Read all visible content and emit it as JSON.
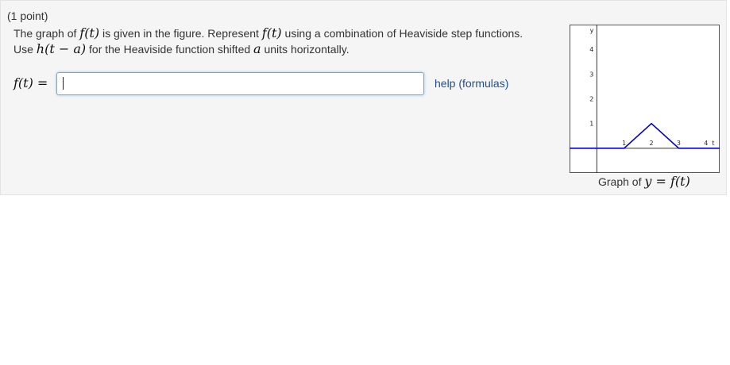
{
  "problem": {
    "points": "(1 point)",
    "line1": {
      "t1": "The graph of ",
      "m1": "f(t)",
      "t2": " is given in the figure. Represent ",
      "m2": "f(t)",
      "t3": " using a combination of Heaviside step functions."
    },
    "line2": {
      "t1": "Use ",
      "m1": "h(t − a)",
      "t2": " for the Heaviside function shifted ",
      "m2": "a",
      "t3": " units horizontally."
    },
    "answer": {
      "label": "f(t) =",
      "value": "",
      "placeholder": ""
    },
    "help_link": "help (formulas)"
  },
  "graph": {
    "xlabel": "t",
    "ylabel": "y",
    "x_ticks": [
      "1",
      "2",
      "3",
      "4"
    ],
    "y_ticks": [
      "1",
      "2",
      "3",
      "4"
    ],
    "curve_color": "#0000cc",
    "grid": true,
    "caption_prefix": "Graph of ",
    "caption_math": "y = f(t)",
    "chart_data": {
      "type": "line",
      "x": [
        -1,
        1,
        2,
        3,
        4.5
      ],
      "y": [
        0,
        0,
        1,
        0,
        0
      ],
      "xlim": [
        -1,
        4.5
      ],
      "ylim": [
        -1,
        5
      ]
    }
  }
}
